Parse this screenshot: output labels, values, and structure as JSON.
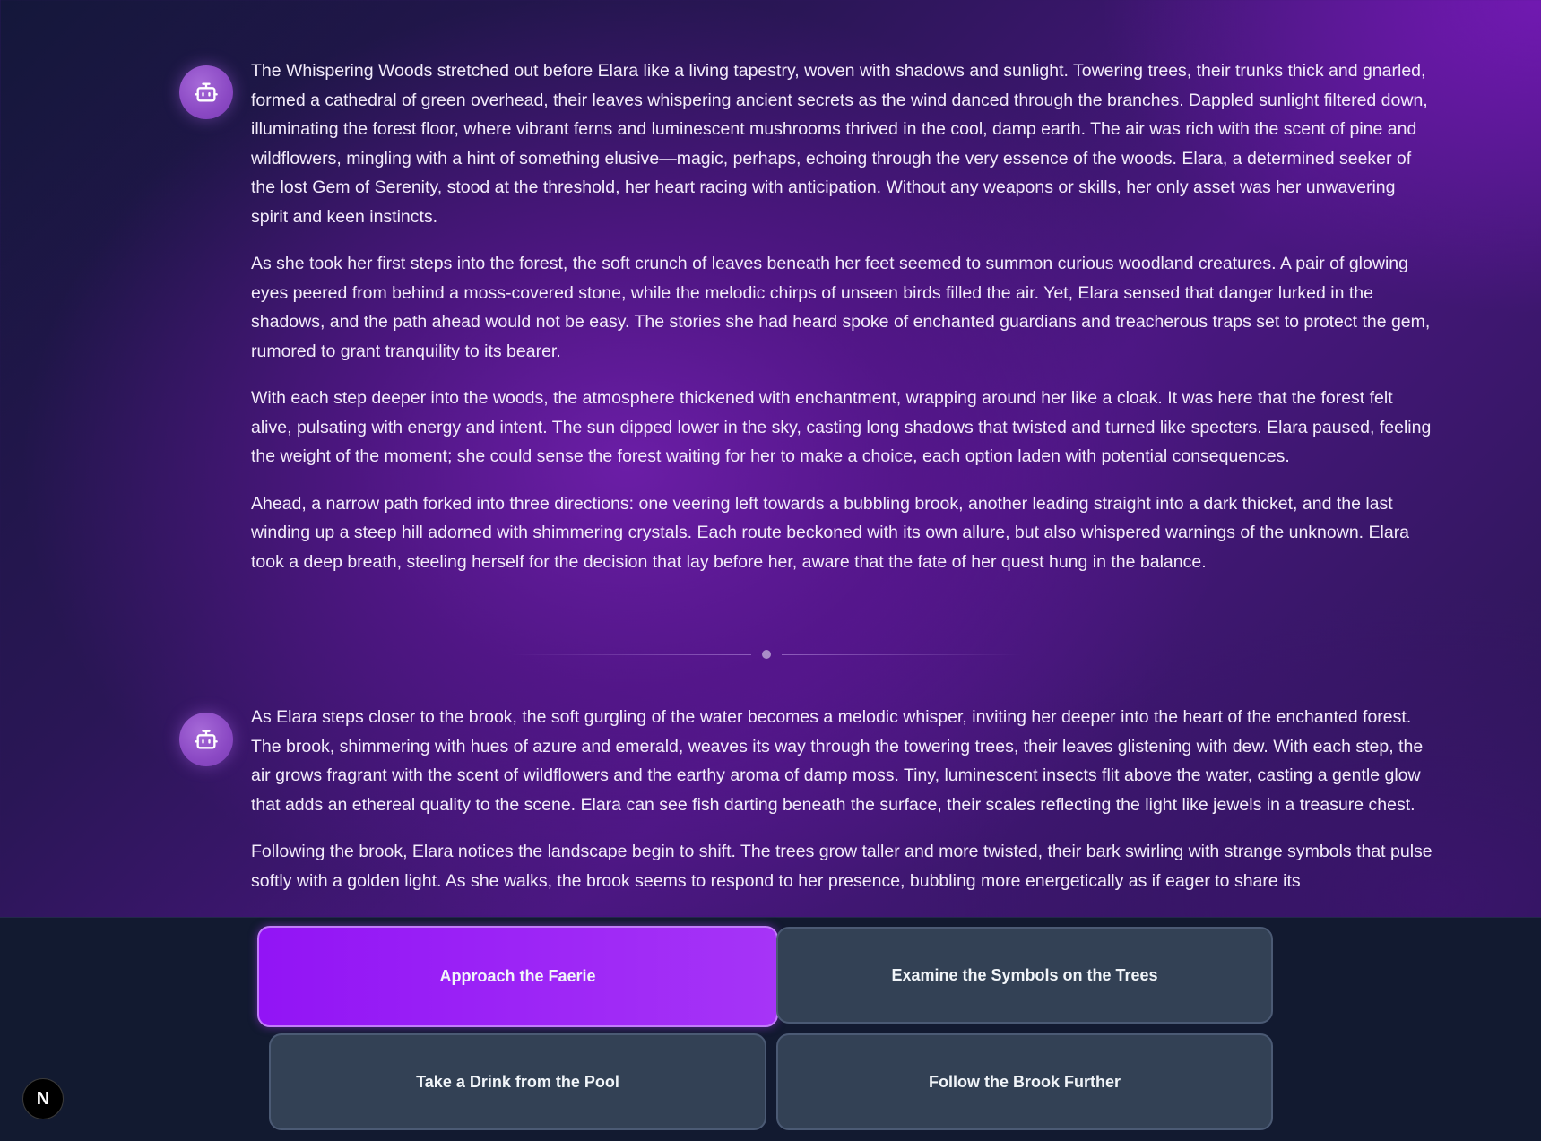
{
  "story": {
    "messages": [
      {
        "avatar_icon": "robot-icon",
        "paragraphs": [
          "The Whispering Woods stretched out before Elara like a living tapestry, woven with shadows and sunlight. Towering trees, their trunks thick and gnarled, formed a cathedral of green overhead, their leaves whispering ancient secrets as the wind danced through the branches. Dappled sunlight filtered down, illuminating the forest floor, where vibrant ferns and luminescent mushrooms thrived in the cool, damp earth. The air was rich with the scent of pine and wildflowers, mingling with a hint of something elusive—magic, perhaps, echoing through the very essence of the woods. Elara, a determined seeker of the lost Gem of Serenity, stood at the threshold, her heart racing with anticipation. Without any weapons or skills, her only asset was her unwavering spirit and keen instincts.",
          "As she took her first steps into the forest, the soft crunch of leaves beneath her feet seemed to summon curious woodland creatures. A pair of glowing eyes peered from behind a moss-covered stone, while the melodic chirps of unseen birds filled the air. Yet, Elara sensed that danger lurked in the shadows, and the path ahead would not be easy. The stories she had heard spoke of enchanted guardians and treacherous traps set to protect the gem, rumored to grant tranquility to its bearer.",
          "With each step deeper into the woods, the atmosphere thickened with enchantment, wrapping around her like a cloak. It was here that the forest felt alive, pulsating with energy and intent. The sun dipped lower in the sky, casting long shadows that twisted and turned like specters. Elara paused, feeling the weight of the moment; she could sense the forest waiting for her to make a choice, each option laden with potential consequences.",
          "Ahead, a narrow path forked into three directions: one veering left towards a bubbling brook, another leading straight into a dark thicket, and the last winding up a steep hill adorned with shimmering crystals. Each route beckoned with its own allure, but also whispered warnings of the unknown. Elara took a deep breath, steeling herself for the decision that lay before her, aware that the fate of her quest hung in the balance."
        ]
      },
      {
        "avatar_icon": "robot-icon",
        "paragraphs": [
          "As Elara steps closer to the brook, the soft gurgling of the water becomes a melodic whisper, inviting her deeper into the heart of the enchanted forest. The brook, shimmering with hues of azure and emerald, weaves its way through the towering trees, their leaves glistening with dew. With each step, the air grows fragrant with the scent of wildflowers and the earthy aroma of damp moss. Tiny, luminescent insects flit above the water, casting a gentle glow that adds an ethereal quality to the scene. Elara can see fish darting beneath the surface, their scales reflecting the light like jewels in a treasure chest.",
          "Following the brook, Elara notices the landscape begin to shift. The trees grow taller and more twisted, their bark swirling with strange symbols that pulse softly with a golden light. As she walks, the brook seems to respond to her presence, bubbling more energetically as if eager to share its"
        ]
      }
    ]
  },
  "choices": [
    {
      "label": "Approach the Faerie",
      "selected": true
    },
    {
      "label": "Examine the Symbols on the Trees",
      "selected": false
    },
    {
      "label": "Take a Drink from the Pool",
      "selected": false
    },
    {
      "label": "Follow the Brook Further",
      "selected": false
    }
  ],
  "badge": {
    "letter": "N"
  },
  "colors": {
    "primary_choice": "#9a1ff6",
    "secondary_choice": "#334155",
    "choice_bar_bg": "#121a30",
    "text": "#f3ecfb"
  }
}
